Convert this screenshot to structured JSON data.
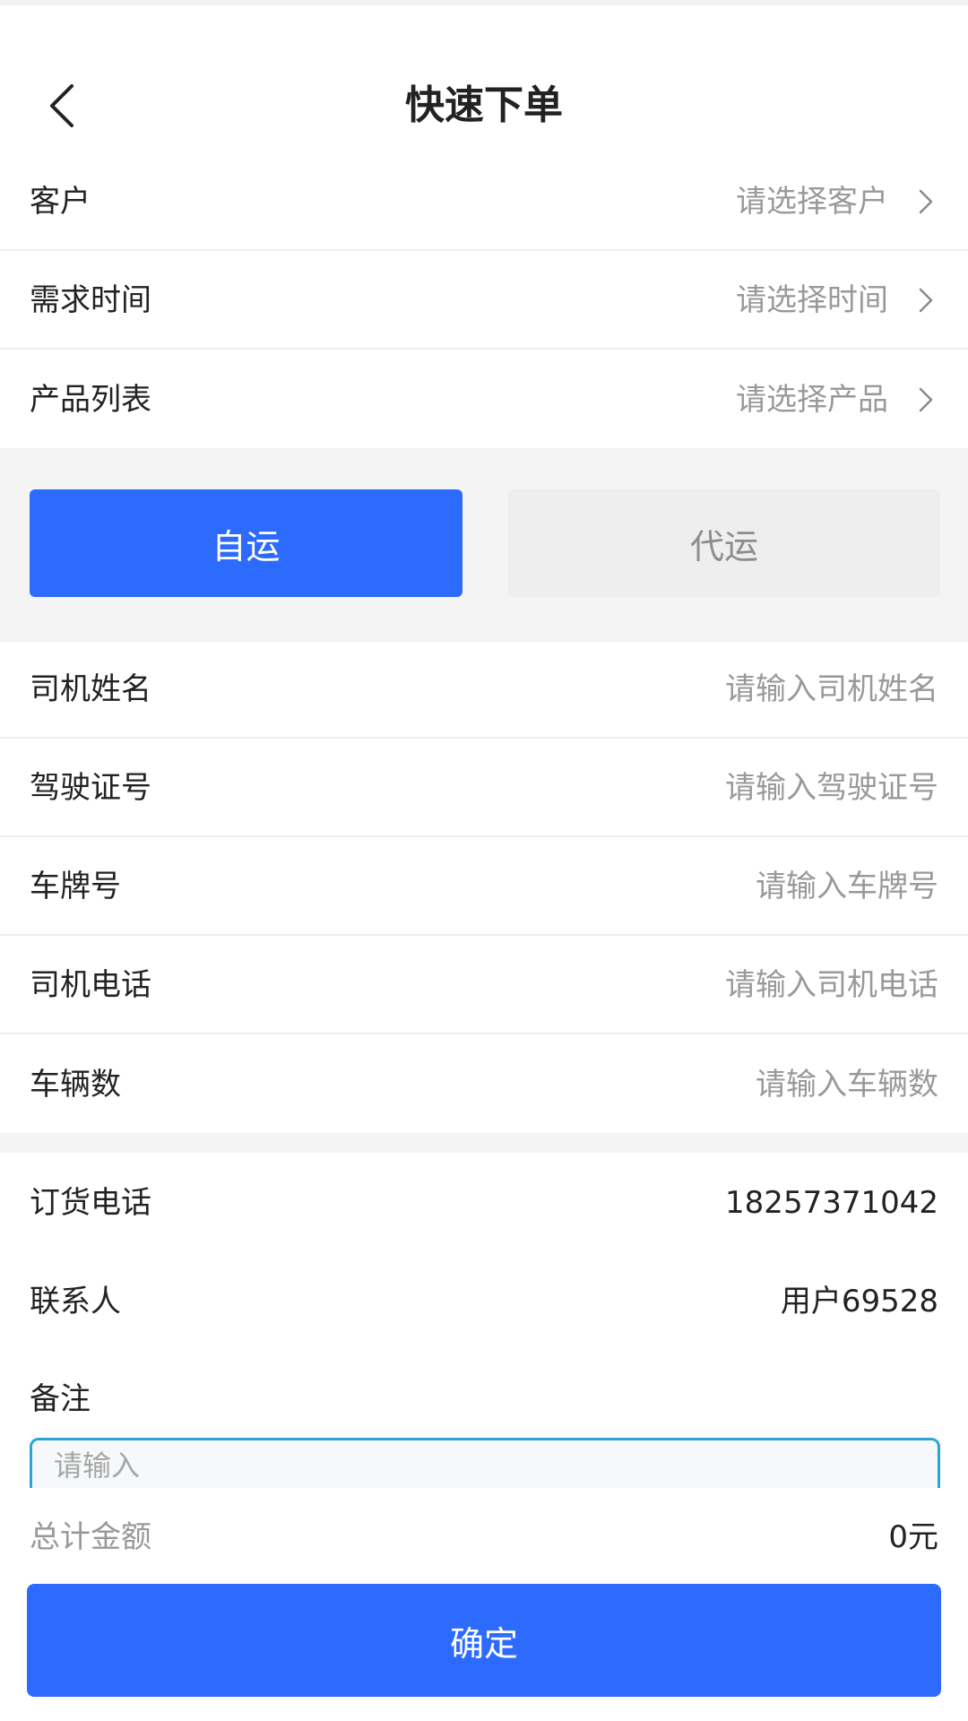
{
  "header": {
    "title": "快速下单"
  },
  "order_form": {
    "customer": {
      "label": "客户",
      "value": "请选择客户"
    },
    "demand_time": {
      "label": "需求时间",
      "value": "请选择时间"
    },
    "product_list": {
      "label": "产品列表",
      "value": "请选择产品"
    }
  },
  "transport_mode": {
    "options": [
      "自运",
      "代运"
    ],
    "selected": "自运"
  },
  "driver_form": {
    "driver_name": {
      "label": "司机姓名",
      "placeholder": "请输入司机姓名"
    },
    "license_no": {
      "label": "驾驶证号",
      "placeholder": "请输入驾驶证号"
    },
    "plate_no": {
      "label": "车牌号",
      "placeholder": "请输入车牌号"
    },
    "driver_phone": {
      "label": "司机电话",
      "placeholder": "请输入司机电话"
    },
    "vehicle_count": {
      "label": "车辆数",
      "placeholder": "请输入车辆数"
    }
  },
  "contact": {
    "order_phone": {
      "label": "订货电话",
      "value": "18257371042"
    },
    "contact_person": {
      "label": "联系人",
      "value": "用户69528"
    }
  },
  "remark": {
    "label": "备注",
    "placeholder": "请输入"
  },
  "footer": {
    "total_label": "总计金额",
    "total_value": "0元",
    "confirm_label": "确定"
  },
  "colors": {
    "primary": "#2d6bff",
    "input_focus_border": "#2aa4d6",
    "placeholder": "#999999",
    "band": "#f4f4f5"
  },
  "icons": {
    "back": "chevron-left-icon",
    "row_arrow": "chevron-right-icon"
  }
}
